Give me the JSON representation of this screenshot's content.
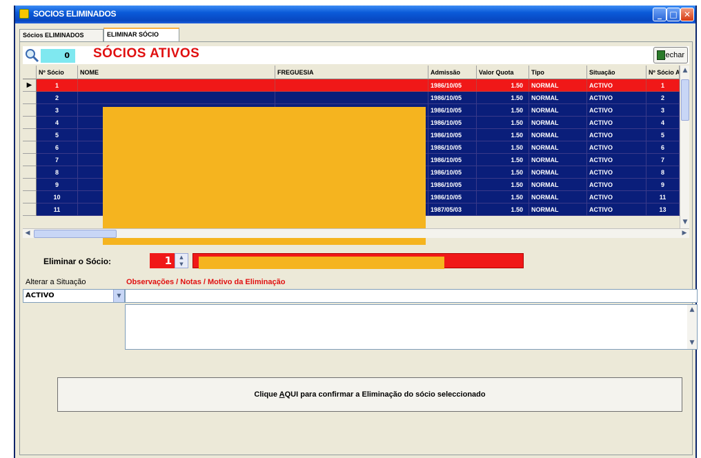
{
  "window": {
    "title": "SOCIOS ELIMINADOS"
  },
  "tabs": [
    {
      "label": "Sócios ELIMINADOS"
    },
    {
      "label": "ELIMINAR SÓCIO"
    }
  ],
  "header": {
    "counter": "0",
    "section_title": "SÓCIOS ATIVOS",
    "fechar_label_u": "F",
    "fechar_label_rest": "echar"
  },
  "grid": {
    "columns": [
      "Nº Sócio",
      "NOME",
      "FREGUESIA",
      "Admissão",
      "Valor Quota",
      "Tipo",
      "Situação",
      "Nº Sócio A"
    ],
    "rows": [
      {
        "num": "1",
        "admissao": "1986/10/05",
        "quota": "1.50",
        "tipo": "NORMAL",
        "situacao": "ACTIVO",
        "num_a": "1",
        "selected": true
      },
      {
        "num": "2",
        "admissao": "1986/10/05",
        "quota": "1.50",
        "tipo": "NORMAL",
        "situacao": "ACTIVO",
        "num_a": "2"
      },
      {
        "num": "3",
        "admissao": "1986/10/05",
        "quota": "1.50",
        "tipo": "NORMAL",
        "situacao": "ACTIVO",
        "num_a": "3"
      },
      {
        "num": "4",
        "admissao": "1986/10/05",
        "quota": "1.50",
        "tipo": "NORMAL",
        "situacao": "ACTIVO",
        "num_a": "4"
      },
      {
        "num": "5",
        "admissao": "1986/10/05",
        "quota": "1.50",
        "tipo": "NORMAL",
        "situacao": "ACTIVO",
        "num_a": "5"
      },
      {
        "num": "6",
        "admissao": "1986/10/05",
        "quota": "1.50",
        "tipo": "NORMAL",
        "situacao": "ACTIVO",
        "num_a": "6"
      },
      {
        "num": "7",
        "admissao": "1986/10/05",
        "quota": "1.50",
        "tipo": "NORMAL",
        "situacao": "ACTIVO",
        "num_a": "7"
      },
      {
        "num": "8",
        "admissao": "1986/10/05",
        "quota": "1.50",
        "tipo": "NORMAL",
        "situacao": "ACTIVO",
        "num_a": "8"
      },
      {
        "num": "9",
        "admissao": "1986/10/05",
        "quota": "1.50",
        "tipo": "NORMAL",
        "situacao": "ACTIVO",
        "num_a": "9"
      },
      {
        "num": "10",
        "admissao": "1986/10/05",
        "quota": "1.50",
        "tipo": "NORMAL",
        "situacao": "ACTIVO",
        "num_a": "11"
      },
      {
        "num": "11",
        "admissao": "1987/05/03",
        "quota": "1.50",
        "tipo": "NORMAL",
        "situacao": "ACTIVO",
        "num_a": "13"
      }
    ]
  },
  "eliminar": {
    "label": "Eliminar o Sócio:",
    "socio_num": "1"
  },
  "situacao": {
    "label": "Alterar a Situação",
    "selected": "ACTIVO"
  },
  "observacoes": {
    "label": "Observações / Notas / Motivo da Eliminação"
  },
  "confirm": {
    "pre": "Clique ",
    "underlined": "A",
    "post": "QUI para confirmar a Eliminação do sócio seleccionado"
  },
  "colors": {
    "grid_row_bg": "#0a1e7a",
    "selected_row_bg": "#f01818",
    "accent_red": "#e01010",
    "redaction": "#f5b41f",
    "counter_bg": "#7fe8f0"
  }
}
